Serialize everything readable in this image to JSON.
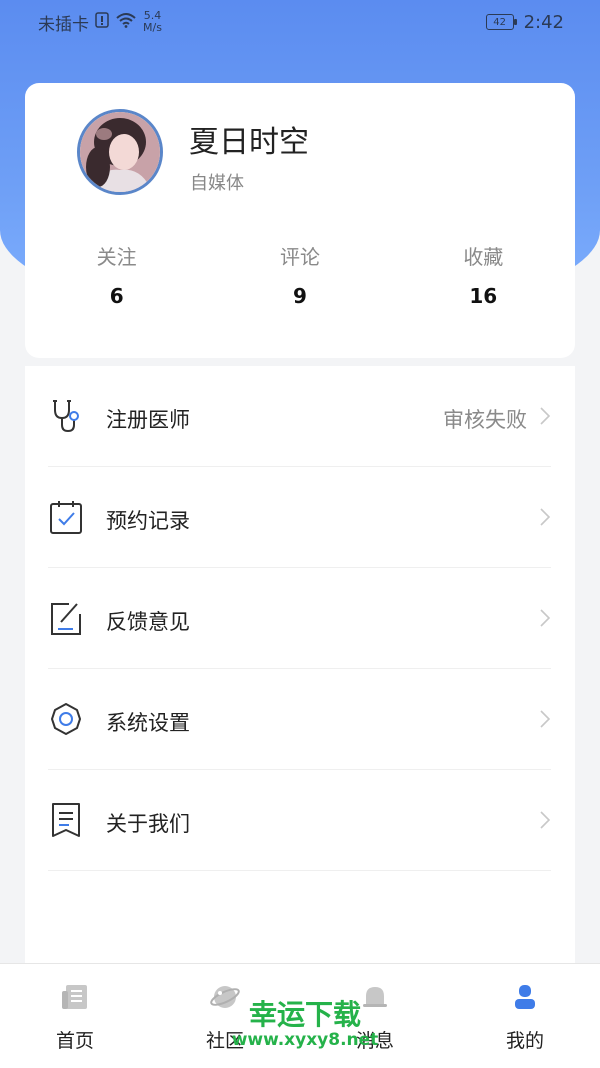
{
  "status_bar": {
    "carrier": "未插卡",
    "speed_value": "5.4",
    "speed_unit": "M/s",
    "battery": "42",
    "time": "2:42"
  },
  "profile": {
    "name": "夏日时空",
    "role": "自媒体",
    "stats": [
      {
        "label": "关注",
        "value": "6"
      },
      {
        "label": "评论",
        "value": "9"
      },
      {
        "label": "收藏",
        "value": "16"
      }
    ]
  },
  "menu": {
    "items": [
      {
        "label": "注册医师",
        "value": "审核失败",
        "icon": "stethoscope-icon"
      },
      {
        "label": "预约记录",
        "value": "",
        "icon": "calendar-check-icon"
      },
      {
        "label": "反馈意见",
        "value": "",
        "icon": "edit-note-icon"
      },
      {
        "label": "系统设置",
        "value": "",
        "icon": "gear-icon"
      },
      {
        "label": "关于我们",
        "value": "",
        "icon": "document-icon"
      }
    ]
  },
  "tabbar": {
    "tabs": [
      {
        "label": "首页",
        "icon": "news-icon",
        "active": false
      },
      {
        "label": "社区",
        "icon": "planet-icon",
        "active": false
      },
      {
        "label": "消息",
        "icon": "bell-icon",
        "active": false
      },
      {
        "label": "我的",
        "icon": "user-icon",
        "active": true
      }
    ]
  },
  "watermark": {
    "text": "幸运下载",
    "url": "www.xyxy8.net"
  },
  "colors": {
    "accent": "#3f7ce8",
    "header_bg": "#6b9cf5",
    "watermark": "#25b24a"
  }
}
